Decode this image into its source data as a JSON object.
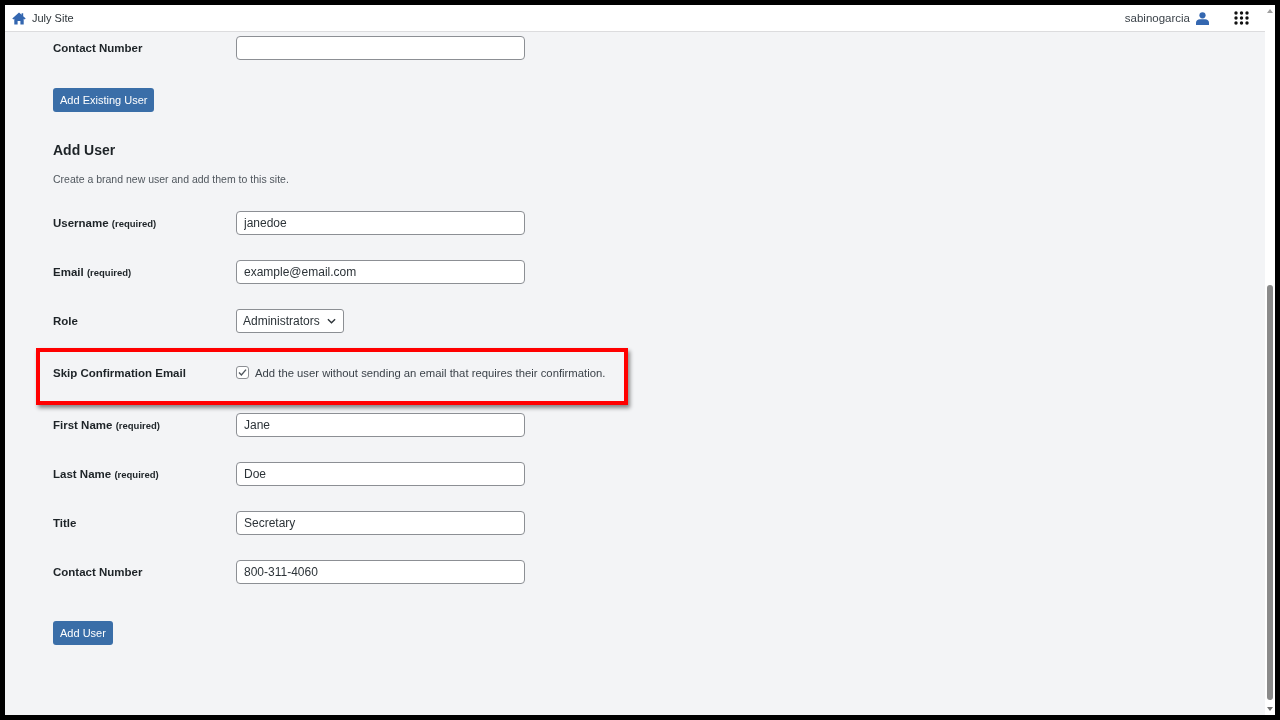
{
  "top_bar": {
    "site_name": "July Site",
    "user_name": "sabinogarcia"
  },
  "existing_user_form": {
    "fields": [
      {
        "kind": "text",
        "label": "Contact Number",
        "highlighted": false
      }
    ],
    "button": "Add Existing User"
  },
  "add_user_form": {
    "title": "Add User",
    "description": "Create a brand new user and add them to this site.",
    "fields": [
      {
        "kind": "text",
        "label": "Username",
        "note": "(required)",
        "value": "janedoe",
        "highlighted": false
      },
      {
        "kind": "text",
        "label": "Email",
        "note": "(required)",
        "value": "example@email.com",
        "highlighted": false
      },
      {
        "kind": "select",
        "label": "Role",
        "value": "Administrators",
        "highlighted": false
      },
      {
        "kind": "checkbox",
        "label": "Skip Confirmation Email",
        "checked": true,
        "text": "Add the user without sending an email that requires their confirmation.",
        "highlighted": true
      },
      {
        "kind": "text",
        "label": "First Name",
        "note": "(required)",
        "value": "Jane",
        "highlighted": false
      },
      {
        "kind": "text",
        "label": "Last Name",
        "note": "(required)",
        "value": "Doe",
        "highlighted": false
      },
      {
        "kind": "text",
        "label": "Title",
        "value": "Secretary",
        "highlighted": false
      },
      {
        "kind": "text",
        "label": "Contact Number",
        "value": "800-311-4060",
        "highlighted": false
      }
    ],
    "button": "Add User"
  }
}
